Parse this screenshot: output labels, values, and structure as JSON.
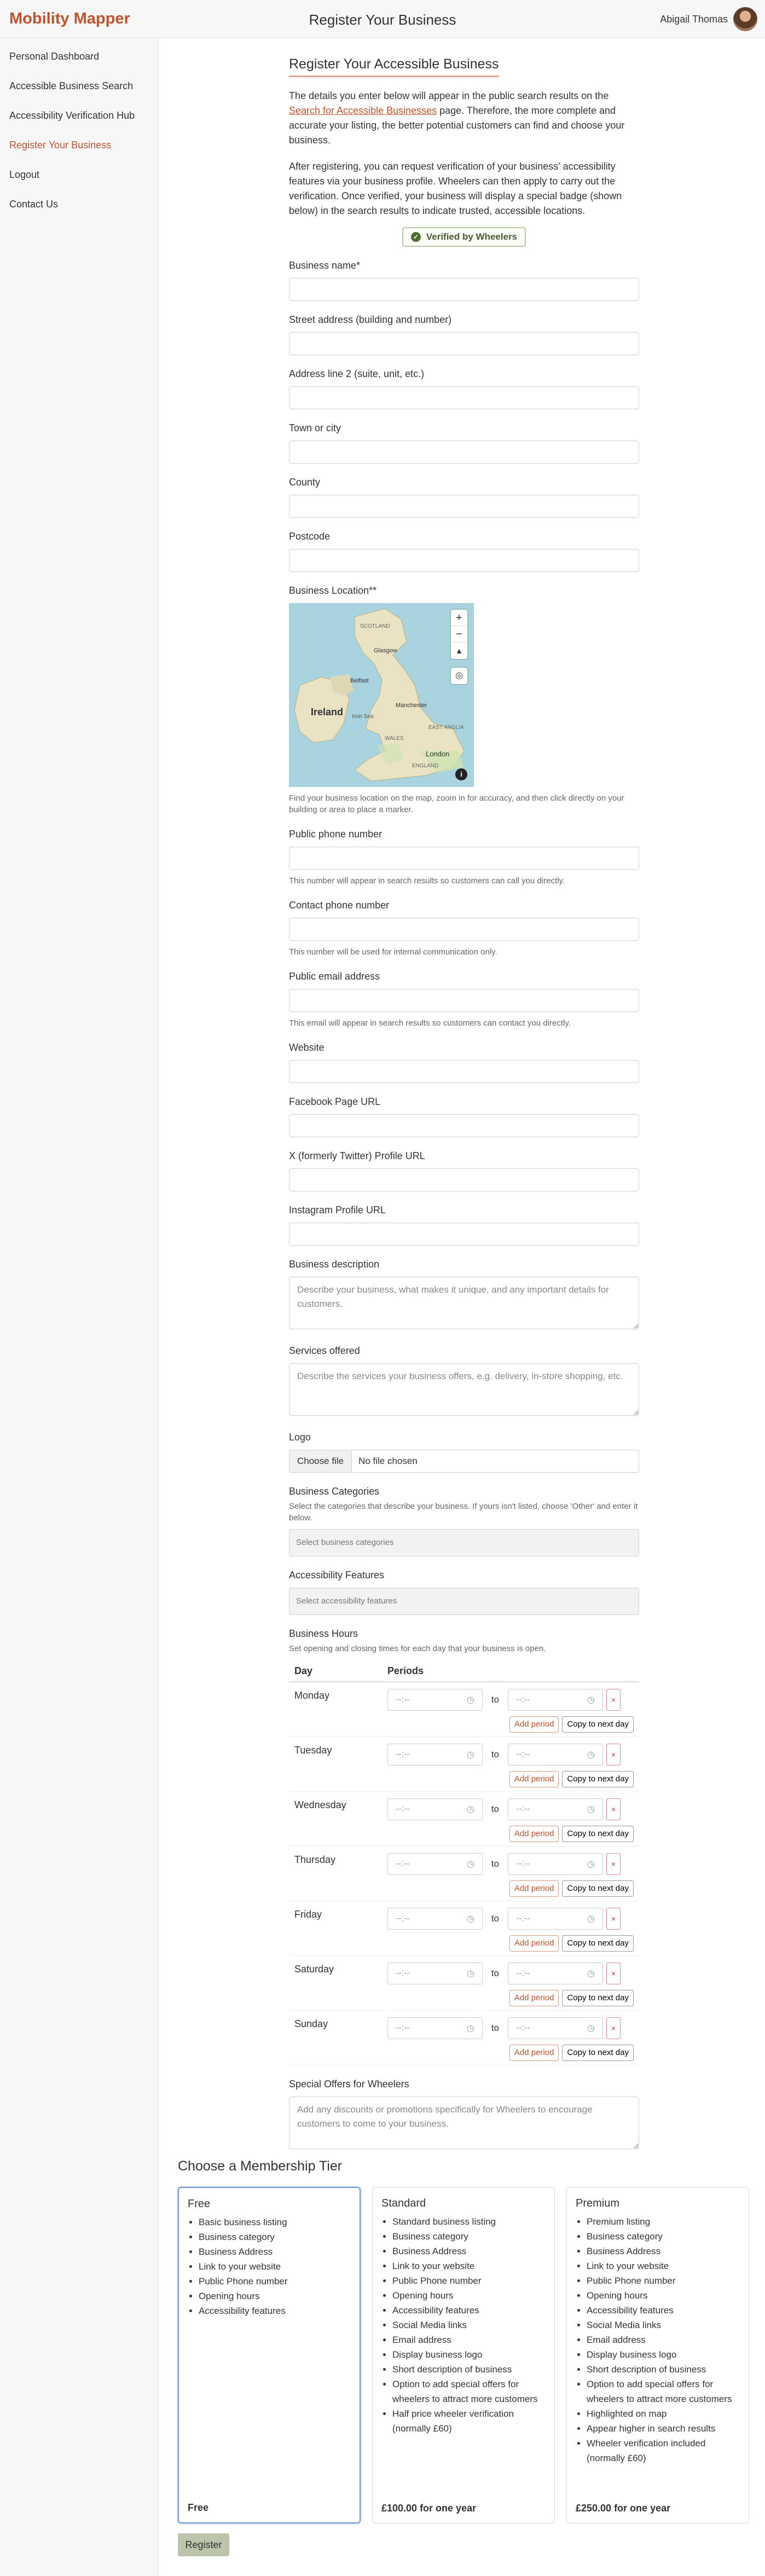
{
  "header": {
    "brand": "Mobility Mapper",
    "title": "Register Your Business",
    "user_name": "Abigail Thomas"
  },
  "sidebar": {
    "items": [
      {
        "label": "Personal Dashboard",
        "active": false
      },
      {
        "label": "Accessible Business Search",
        "active": false
      },
      {
        "label": "Accessibility Verification Hub",
        "active": false
      },
      {
        "label": "Register Your Business",
        "active": true
      },
      {
        "label": "Logout",
        "active": false
      },
      {
        "label": "Contact Us",
        "active": false
      }
    ]
  },
  "form": {
    "heading": "Register Your Accessible Business",
    "intro1_before": "The details you enter below will appear in the public search results on the ",
    "intro1_link": "Search for Accessible Businesses",
    "intro1_after": " page. Therefore, the more complete and accurate your listing, the better potential customers can find and choose your business.",
    "intro2": "After registering, you can request verification of your business' accessibility features via your business profile. Wheelers can then apply to carry out the verification. Once verified, your business will display a special badge (shown below) in the search results to indicate trusted, accessible locations.",
    "badge": "Verified by Wheelers",
    "business_name": "Business name*",
    "street": "Street address (building and number)",
    "address2": "Address line 2 (suite, unit, etc.)",
    "town": "Town or city",
    "county": "County",
    "postcode": "Postcode",
    "location": "Business Location**",
    "map_labels": {
      "scotland": "SCOTLAND",
      "glasgow": "Glasgow",
      "belfast": "Belfast",
      "ireland": "Ireland",
      "irish_sea": "Irish Sea",
      "manchester": "Manchester",
      "wales": "WALES",
      "east_anglia": "EAST ANGLIA",
      "london": "London",
      "england": "ENGLAND"
    },
    "location_help": "Find your business location on the map, zoom in for accuracy, and then click directly on your building or area to place a marker.",
    "public_phone": "Public phone number",
    "public_phone_help": "This number will appear in search results so customers can call you directly.",
    "contact_phone": "Contact phone number",
    "contact_phone_help": "This number will be used for internal communication only.",
    "public_email": "Public email address",
    "public_email_help": "This email will appear in search results so customers can contact you directly.",
    "website": "Website",
    "facebook": "Facebook Page URL",
    "twitter": "X (formerly Twitter) Profile URL",
    "instagram": "Instagram Profile URL",
    "description": "Business description",
    "description_ph": "Describe your business, what makes it unique, and any important details for customers.",
    "services": "Services offered",
    "services_ph": "Describe the services your business offers, e.g. delivery, in-store shopping, etc.",
    "logo": "Logo",
    "file_btn": "Choose file",
    "file_status": "No file chosen",
    "categories": "Business Categories",
    "categories_help": "Select the categories that describe your business. If yours isn't listed, choose 'Other' and enter it below.",
    "categories_ph": "Select business categories",
    "features": "Accessibility Features",
    "features_ph": "Select accessibility features",
    "hours": "Business Hours",
    "hours_help": "Set opening and closing times for each day that your business is open.",
    "col_day": "Day",
    "col_periods": "Periods",
    "time_ph": "--:--",
    "to": "to",
    "remove": "×",
    "add_period": "Add period",
    "copy_next": "Copy to next day",
    "days": [
      "Monday",
      "Tuesday",
      "Wednesday",
      "Thursday",
      "Friday",
      "Saturday",
      "Sunday"
    ],
    "offers": "Special Offers for Wheelers",
    "offers_ph": "Add any discounts or promotions specifically for Wheelers to encourage customers to come to your business."
  },
  "membership": {
    "heading": "Choose a Membership Tier",
    "tiers": [
      {
        "name": "Free",
        "price": "Free",
        "selected": true,
        "features": [
          "Basic business listing",
          "Business category",
          "Business Address",
          "Link to your website",
          "Public Phone number",
          "Opening hours",
          "Accessibility features"
        ]
      },
      {
        "name": "Standard",
        "price": "£100.00 for one year",
        "selected": false,
        "features": [
          "Standard business listing",
          "Business category",
          "Business Address",
          "Link to your website",
          "Public Phone number",
          "Opening hours",
          "Accessibility features",
          "Social Media links",
          "Email address",
          "Display business logo",
          "Short description of business",
          "Option to add special offers for wheelers to attract more customers",
          "Half price wheeler verification (normally £60)"
        ]
      },
      {
        "name": "Premium",
        "price": "£250.00 for one year",
        "selected": false,
        "features": [
          "Premium listing",
          "Business category",
          "Business Address",
          "Link to your website",
          "Public Phone number",
          "Opening hours",
          "Accessibility features",
          "Social Media links",
          "Email address",
          "Display business logo",
          "Short description of business",
          "Option to add special offers for wheelers to attract more customers",
          "Highlighted on map",
          "Appear higher in search results",
          "Wheeler verification included (normally £60)"
        ]
      }
    ],
    "register": "Register"
  },
  "colors": {
    "brand": "#c2522c",
    "badge_green": "#4f6e2f",
    "selected_tier": "#6f97e0"
  }
}
